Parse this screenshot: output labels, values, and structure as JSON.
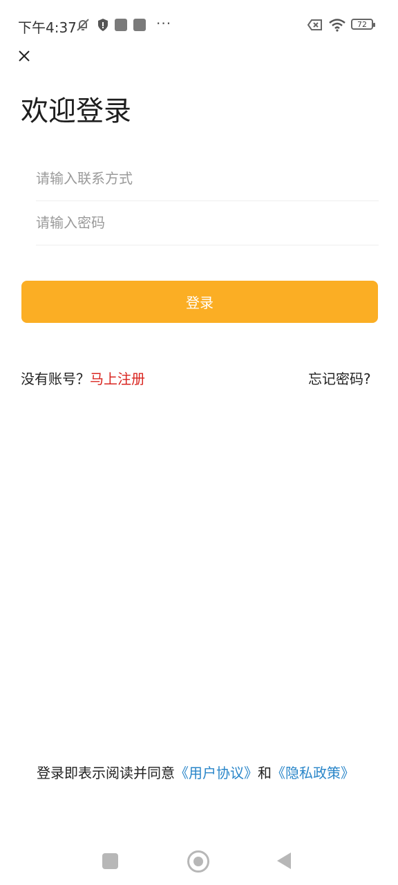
{
  "status_bar": {
    "time": "下午4:37",
    "battery": "72"
  },
  "page": {
    "title": "欢迎登录"
  },
  "form": {
    "contact_placeholder": "请输入联系方式",
    "password_placeholder": "请输入密码",
    "login_label": "登录"
  },
  "links": {
    "no_account": "没有账号？",
    "register": "马上注册",
    "forgot": "忘记密码?"
  },
  "agreement": {
    "prefix": "登录即表示阅读并同意",
    "user_agreement": "《用户协议》",
    "and": "和",
    "privacy_policy": "《隐私政策》"
  },
  "colors": {
    "accent": "#fbae24",
    "register": "#d9241f",
    "link": "#2a86c9"
  }
}
